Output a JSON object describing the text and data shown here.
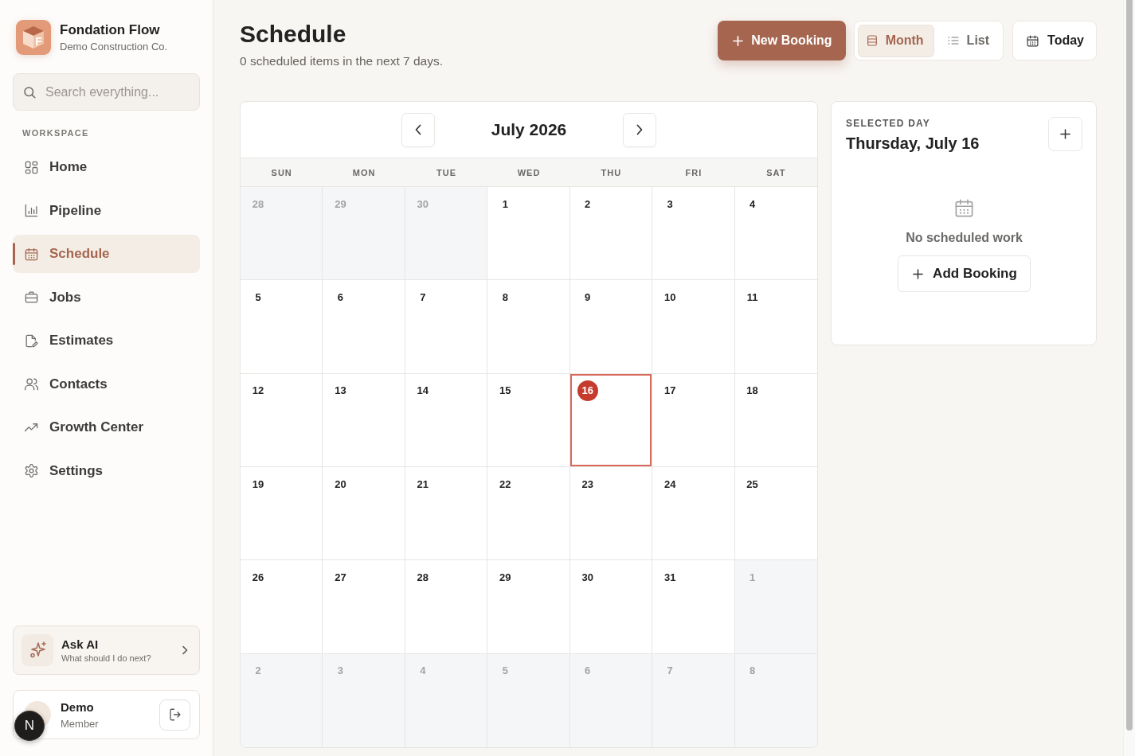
{
  "sidebar": {
    "brand": {
      "logo_letter": "F",
      "name": "Fondation Flow",
      "subtitle": "Demo Construction Co."
    },
    "search": {
      "placeholder": "Search everything..."
    },
    "section_label": "WORKSPACE",
    "items": [
      {
        "label": "Home",
        "selected": false
      },
      {
        "label": "Pipeline",
        "selected": false
      },
      {
        "label": "Schedule",
        "selected": true
      },
      {
        "label": "Jobs",
        "selected": false
      },
      {
        "label": "Estimates",
        "selected": false
      },
      {
        "label": "Contacts",
        "selected": false
      },
      {
        "label": "Growth Center",
        "selected": false
      },
      {
        "label": "Settings",
        "selected": false
      }
    ],
    "assistant": {
      "title": "Ask AI",
      "subtitle": "What should I do next?"
    },
    "user": {
      "name": "Demo",
      "role": "Member"
    },
    "dev_tools": {
      "label": "N"
    }
  },
  "header": {
    "title": "Schedule",
    "subtitle": "0 scheduled items in the next 7 days."
  },
  "toolbar": {
    "primary": {
      "label": "New Booking"
    },
    "views": [
      {
        "label": "Month",
        "selected": true
      },
      {
        "label": "List",
        "selected": false
      }
    ],
    "today": {
      "label": "Today"
    }
  },
  "calendar": {
    "title": "July 2026",
    "weekdays": [
      "SUN",
      "MON",
      "TUE",
      "WED",
      "THU",
      "FRI",
      "SAT"
    ],
    "days": [
      {
        "label": "28",
        "outside": true,
        "today": false,
        "selected": false
      },
      {
        "label": "29",
        "outside": true,
        "today": false,
        "selected": false
      },
      {
        "label": "30",
        "outside": true,
        "today": false,
        "selected": false
      },
      {
        "label": "1",
        "outside": false,
        "today": false,
        "selected": false
      },
      {
        "label": "2",
        "outside": false,
        "today": false,
        "selected": false
      },
      {
        "label": "3",
        "outside": false,
        "today": false,
        "selected": false
      },
      {
        "label": "4",
        "outside": false,
        "today": false,
        "selected": false
      },
      {
        "label": "5",
        "outside": false,
        "today": false,
        "selected": false
      },
      {
        "label": "6",
        "outside": false,
        "today": false,
        "selected": false
      },
      {
        "label": "7",
        "outside": false,
        "today": false,
        "selected": false
      },
      {
        "label": "8",
        "outside": false,
        "today": false,
        "selected": false
      },
      {
        "label": "9",
        "outside": false,
        "today": false,
        "selected": false
      },
      {
        "label": "10",
        "outside": false,
        "today": false,
        "selected": false
      },
      {
        "label": "11",
        "outside": false,
        "today": false,
        "selected": false
      },
      {
        "label": "12",
        "outside": false,
        "today": false,
        "selected": false
      },
      {
        "label": "13",
        "outside": false,
        "today": false,
        "selected": false
      },
      {
        "label": "14",
        "outside": false,
        "today": false,
        "selected": false
      },
      {
        "label": "15",
        "outside": false,
        "today": false,
        "selected": false
      },
      {
        "label": "16",
        "outside": false,
        "today": true,
        "selected": true
      },
      {
        "label": "17",
        "outside": false,
        "today": false,
        "selected": false
      },
      {
        "label": "18",
        "outside": false,
        "today": false,
        "selected": false
      },
      {
        "label": "19",
        "outside": false,
        "today": false,
        "selected": false
      },
      {
        "label": "20",
        "outside": false,
        "today": false,
        "selected": false
      },
      {
        "label": "21",
        "outside": false,
        "today": false,
        "selected": false
      },
      {
        "label": "22",
        "outside": false,
        "today": false,
        "selected": false
      },
      {
        "label": "23",
        "outside": false,
        "today": false,
        "selected": false
      },
      {
        "label": "24",
        "outside": false,
        "today": false,
        "selected": false
      },
      {
        "label": "25",
        "outside": false,
        "today": false,
        "selected": false
      },
      {
        "label": "26",
        "outside": false,
        "today": false,
        "selected": false
      },
      {
        "label": "27",
        "outside": false,
        "today": false,
        "selected": false
      },
      {
        "label": "28",
        "outside": false,
        "today": false,
        "selected": false
      },
      {
        "label": "29",
        "outside": false,
        "today": false,
        "selected": false
      },
      {
        "label": "30",
        "outside": false,
        "today": false,
        "selected": false
      },
      {
        "label": "31",
        "outside": false,
        "today": false,
        "selected": false
      },
      {
        "label": "1",
        "outside": true,
        "today": false,
        "selected": false
      },
      {
        "label": "2",
        "outside": true,
        "today": false,
        "selected": false
      },
      {
        "label": "3",
        "outside": true,
        "today": false,
        "selected": false
      },
      {
        "label": "4",
        "outside": true,
        "today": false,
        "selected": false
      },
      {
        "label": "5",
        "outside": true,
        "today": false,
        "selected": false
      },
      {
        "label": "6",
        "outside": true,
        "today": false,
        "selected": false
      },
      {
        "label": "7",
        "outside": true,
        "today": false,
        "selected": false
      },
      {
        "label": "8",
        "outside": true,
        "today": false,
        "selected": false
      }
    ]
  },
  "selected_day": {
    "eyebrow": "SELECTED DAY",
    "title": "Thursday, July 16",
    "empty_text": "No scheduled work",
    "action": {
      "label": "Add Booking"
    }
  }
}
